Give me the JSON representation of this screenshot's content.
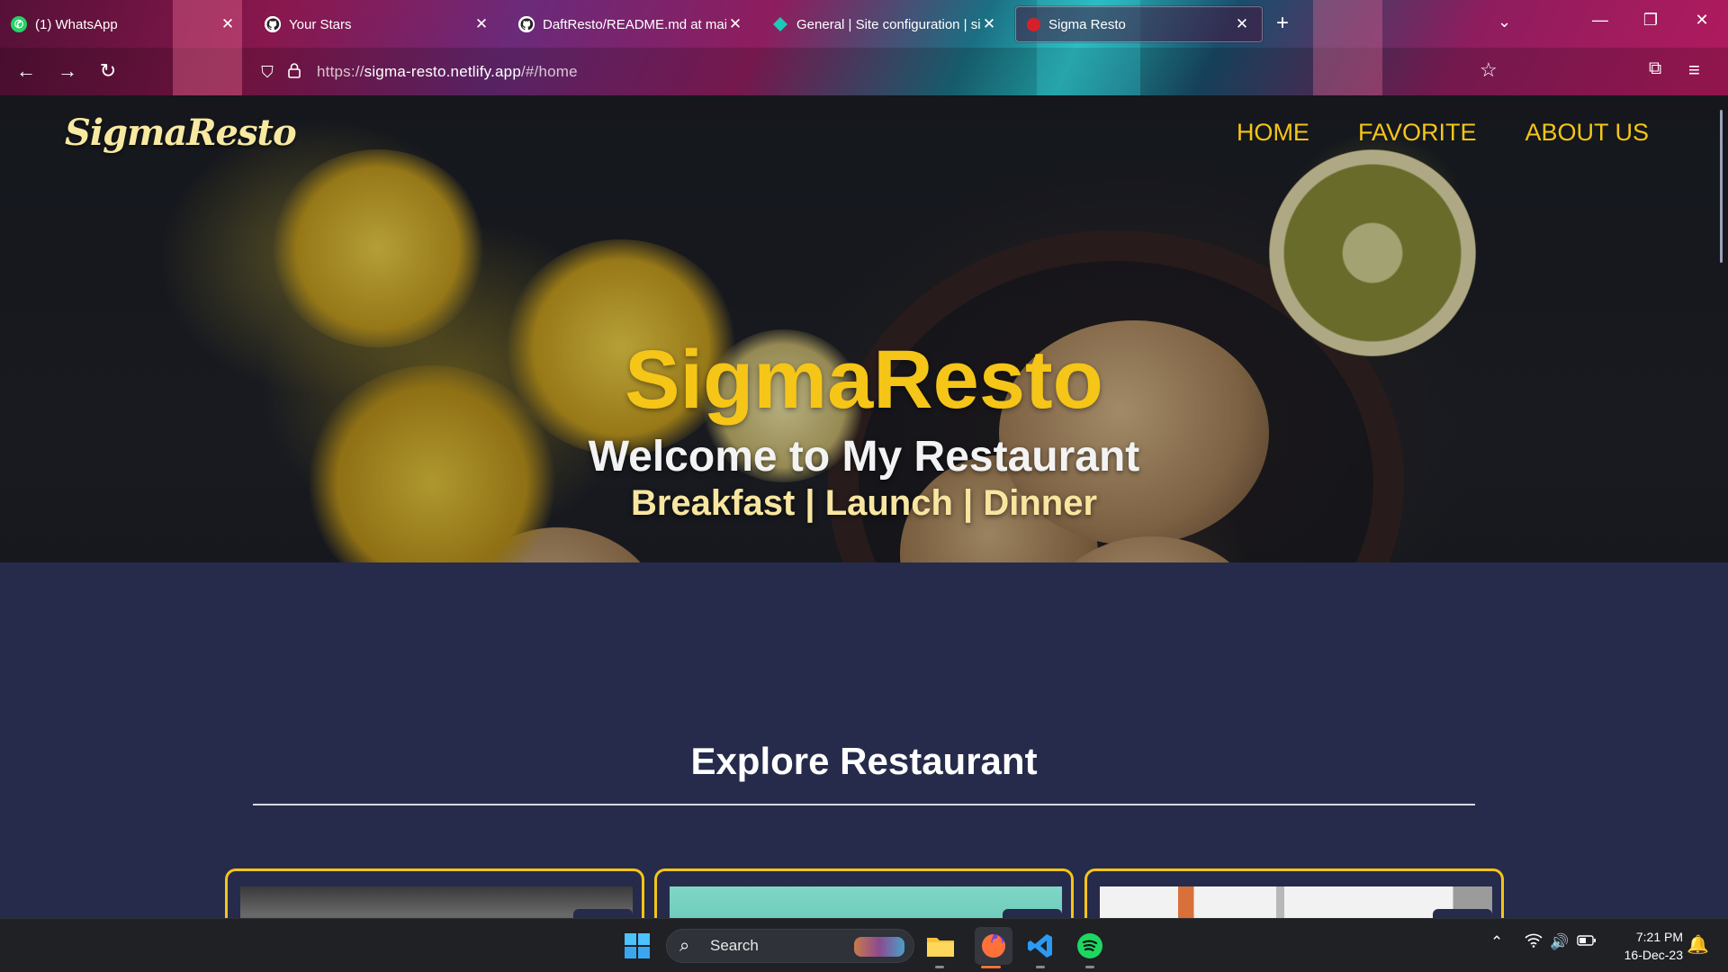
{
  "browser": {
    "tabs": [
      {
        "title": "(1) WhatsApp",
        "favicon": "whatsapp-icon",
        "active": false
      },
      {
        "title": "Your Stars",
        "favicon": "github-icon",
        "active": false
      },
      {
        "title": "DaftResto/README.md at main",
        "favicon": "github-icon",
        "active": false
      },
      {
        "title": "General | Site configuration | sig",
        "favicon": "netlify-icon",
        "active": false
      },
      {
        "title": "Sigma Resto",
        "favicon": "site-icon",
        "active": true
      }
    ],
    "url": {
      "scheme": "https://",
      "host": "sigma-resto.netlify.app",
      "path": "/#/home"
    },
    "icons": {
      "back": "←",
      "forward": "→",
      "reload": "↻",
      "shield": "⛉",
      "lock": "🔒",
      "bookmark": "☆",
      "extensions": "⧉",
      "menu": "≡",
      "new_tab": "+",
      "tab_list": "⌄",
      "minimize": "—",
      "restore": "❐",
      "close": "✕",
      "tab_close": "✕"
    }
  },
  "site": {
    "logo": "SigmaResto",
    "nav": [
      "HOME",
      "FAVORITE",
      "ABOUT US"
    ],
    "hero": {
      "title": "SigmaResto",
      "subtitle": "Welcome to My Restaurant",
      "meals": "Breakfast | Launch | Dinner"
    },
    "section_title": "Explore Restaurant",
    "accent_color": "#f5c518",
    "background_color": "#262b4b"
  },
  "taskbar": {
    "search_label": "Search",
    "time": "7:21 PM",
    "date": "16-Dec-23",
    "icons": {
      "start": "windows-start-icon",
      "search": "⌕",
      "tray_chevron": "⌃",
      "wifi": "wifi-icon",
      "volume": "🔊",
      "battery": "battery-icon",
      "notifications": "🔔"
    }
  }
}
